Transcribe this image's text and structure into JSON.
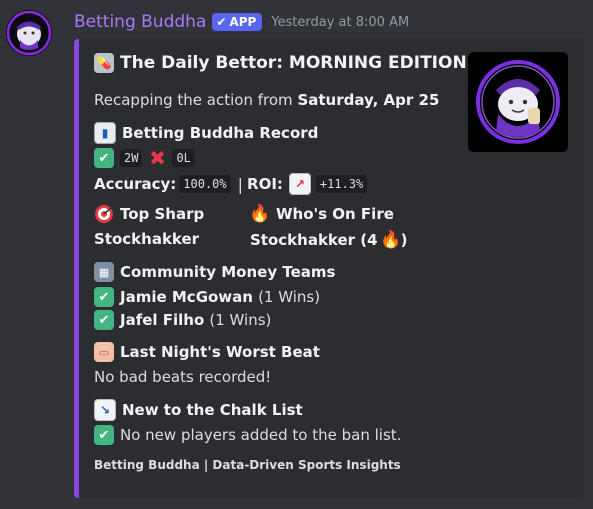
{
  "message": {
    "bot_name": "Betting Buddha",
    "app_badge": "APP",
    "timestamp": "Yesterday at 8:00 AM"
  },
  "embed": {
    "accent_color": "#8f46e0",
    "title": "The Daily Bettor: MORNING EDITION",
    "recap_prefix": "Recapping the action from",
    "recap_date": "Saturday, Apr 25",
    "record": {
      "heading": "Betting Buddha Record",
      "wins": "2W",
      "losses": "0L",
      "accuracy_label": "Accuracy:",
      "accuracy_value": "100.0%",
      "separator": "|",
      "roi_label": "ROI:",
      "roi_value": "+11.3%"
    },
    "top_sharp": {
      "heading": "Top Sharp",
      "name": "Stockhakker"
    },
    "on_fire": {
      "heading": "Who's On Fire",
      "name": "Stockhakker (4"
    },
    "community": {
      "heading": "Community Money Teams",
      "teams": [
        {
          "name": "Jamie McGowan",
          "wins": "(1 Wins)"
        },
        {
          "name": "Jafel Filho",
          "wins": "(1 Wins)"
        }
      ]
    },
    "worst_beat": {
      "heading": "Last Night's Worst Beat",
      "text": "No bad beats recorded!"
    },
    "chalk": {
      "heading": "New to the Chalk List",
      "text": "No new players added to the ban list."
    },
    "footer": "Betting Buddha | Data-Driven Sports Insights"
  }
}
